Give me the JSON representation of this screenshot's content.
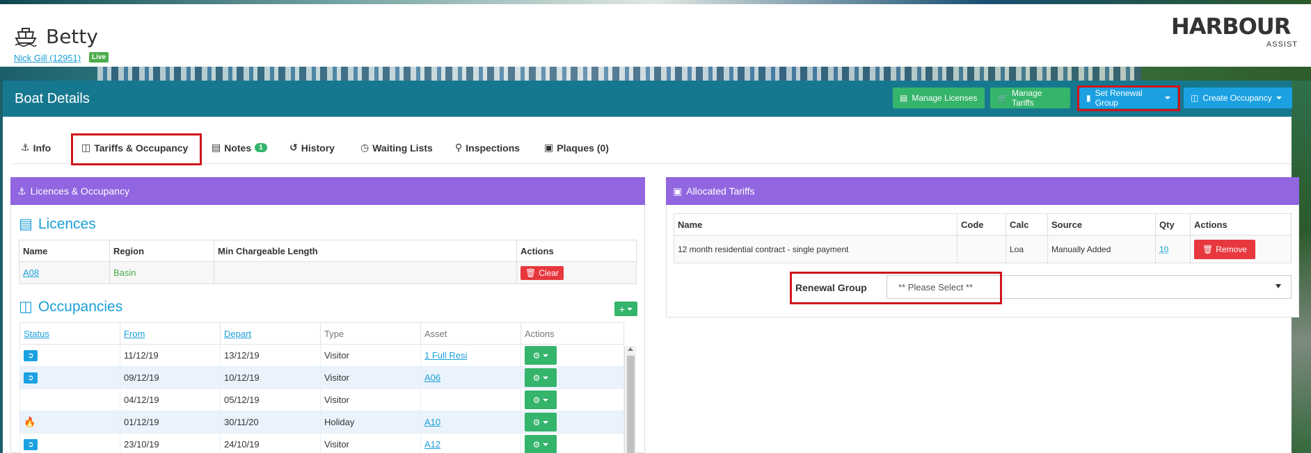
{
  "header": {
    "boat_name": "Betty",
    "owner_link": "Nick Gill (12951)",
    "status_badge": "Live",
    "logo_main": "HARBOUR",
    "logo_sub": "ASSIST"
  },
  "titlebar": {
    "title": "Boat Details",
    "buttons": {
      "manage_licenses": "Manage Licenses",
      "manage_tariffs": "Manage Tariffs",
      "set_renewal_group": "Set Renewal Group",
      "create_occupancy": "Create Occupancy"
    }
  },
  "tabs": {
    "info": "Info",
    "tariffs": "Tariffs & Occupancy",
    "notes": "Notes",
    "notes_count": "1",
    "history": "History",
    "waiting": "Waiting Lists",
    "inspections": "Inspections",
    "plaques": "Plaques (0)"
  },
  "licences_panel": {
    "heading": "Licences & Occupancy",
    "licences_title": "Licences",
    "columns": [
      "Name",
      "Region",
      "Min Chargeable Length",
      "Actions"
    ],
    "rows": [
      {
        "name": "A08",
        "region": "Basin",
        "min_length": "",
        "action": "Clear"
      }
    ],
    "occupancies_title": "Occupancies",
    "occ_columns": [
      "Status",
      "From",
      "Depart",
      "Type",
      "Asset",
      "Actions"
    ],
    "occ_rows": [
      {
        "status": "departed",
        "from": "11/12/19",
        "depart": "13/12/19",
        "type": "Visitor",
        "asset": "1 Full Resi"
      },
      {
        "status": "departed",
        "from": "09/12/19",
        "depart": "10/12/19",
        "type": "Visitor",
        "asset": "A06"
      },
      {
        "status": "",
        "from": "04/12/19",
        "depart": "05/12/19",
        "type": "Visitor",
        "asset": ""
      },
      {
        "status": "fire",
        "from": "01/12/19",
        "depart": "30/11/20",
        "type": "Holiday",
        "asset": "A10"
      },
      {
        "status": "departed",
        "from": "23/10/19",
        "depart": "24/10/19",
        "type": "Visitor",
        "asset": "A12"
      }
    ]
  },
  "tariffs_panel": {
    "heading": "Allocated Tariffs",
    "columns": [
      "Name",
      "Code",
      "Calc",
      "Source",
      "Qty",
      "Actions"
    ],
    "rows": [
      {
        "name": "12 month residential contract - single payment",
        "code": "",
        "calc": "Loa",
        "source": "Manually Added",
        "qty": "10",
        "action": "Remove"
      }
    ],
    "renewal_label": "Renewal Group",
    "renewal_placeholder": "** Please Select **"
  },
  "colors": {
    "title_bar": "#16788f",
    "purple_header": "#9166e0",
    "green_button": "#35b46b",
    "blue_button": "#1ba1e2",
    "red_button": "#e7383e",
    "highlight_box": "#d0151b",
    "link": "#1a9fd8"
  }
}
